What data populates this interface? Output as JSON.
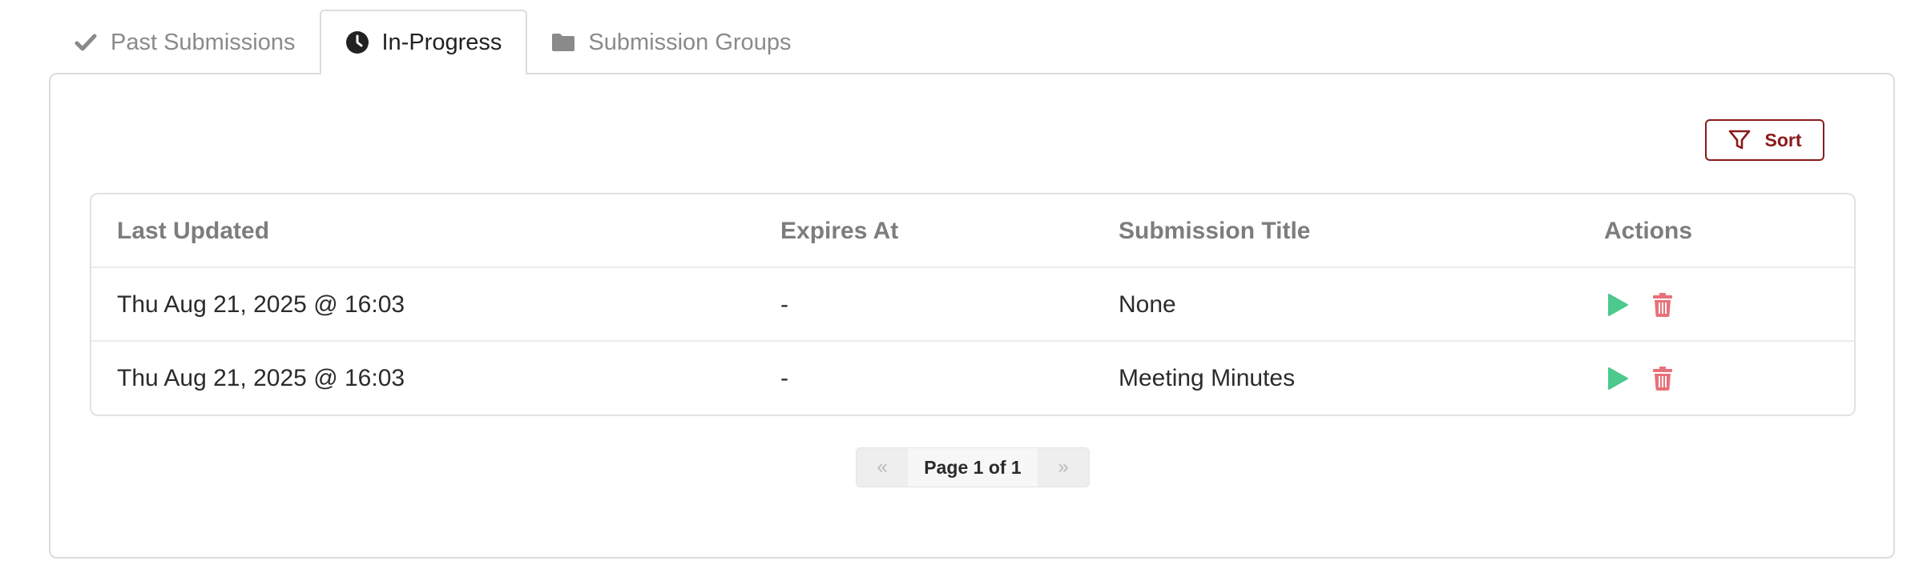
{
  "tabs": [
    {
      "label": "Past Submissions",
      "icon": "check-icon",
      "active": false
    },
    {
      "label": "In-Progress",
      "icon": "clock-icon",
      "active": true
    },
    {
      "label": "Submission Groups",
      "icon": "folder-icon",
      "active": false
    }
  ],
  "toolbar": {
    "sort_label": "Sort",
    "sort_icon": "filter-icon"
  },
  "table": {
    "headers": [
      "Last Updated",
      "Expires At",
      "Submission Title",
      "Actions"
    ],
    "rows": [
      {
        "last_updated": "Thu Aug 21, 2025 @ 16:03",
        "expires_at": "-",
        "title": "None",
        "actions": [
          "play-icon",
          "trash-icon"
        ]
      },
      {
        "last_updated": "Thu Aug 21, 2025 @ 16:03",
        "expires_at": "-",
        "title": "Meeting Minutes",
        "actions": [
          "play-icon",
          "trash-icon"
        ]
      }
    ]
  },
  "pagination": {
    "prev_label": "«",
    "current_label": "Page 1 of 1",
    "next_label": "»"
  },
  "colors": {
    "accent": "#8b1a1a",
    "play": "#4cc98d",
    "delete": "#e8707a",
    "muted_text": "#8a8a8a"
  }
}
